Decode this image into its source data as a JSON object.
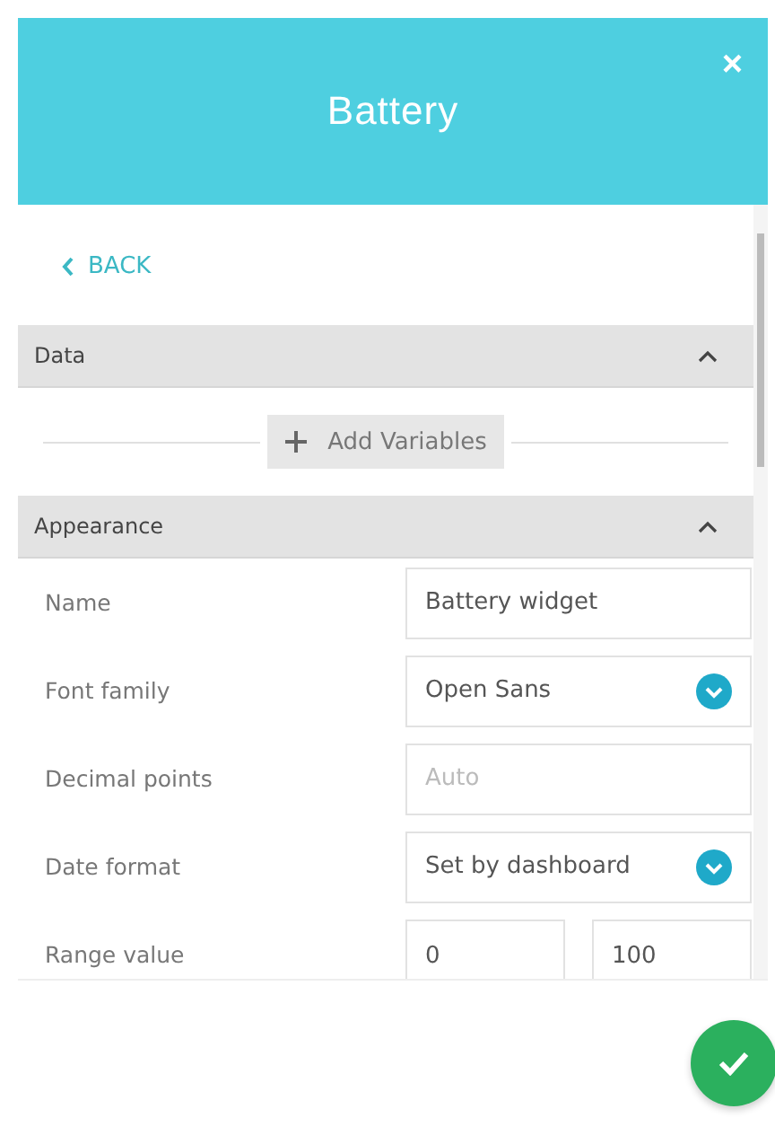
{
  "dialog": {
    "title": "Battery",
    "close": "×"
  },
  "back": {
    "label": "BACK"
  },
  "sections": [
    {
      "title": "Data",
      "expanded": true,
      "add_button": "Add Variables"
    },
    {
      "title": "Appearance",
      "expanded": true,
      "fields": [
        {
          "kind": "input",
          "label": "Name",
          "value": "Battery widget"
        },
        {
          "kind": "select",
          "label": "Font family",
          "value": "Open Sans"
        },
        {
          "kind": "input",
          "label": "Decimal points",
          "placeholder": "Auto"
        },
        {
          "kind": "select",
          "label": "Date format",
          "value": "Set by dashboard"
        },
        {
          "kind": "range",
          "label": "Range value",
          "values": [
            "0",
            "100"
          ]
        }
      ]
    }
  ]
}
